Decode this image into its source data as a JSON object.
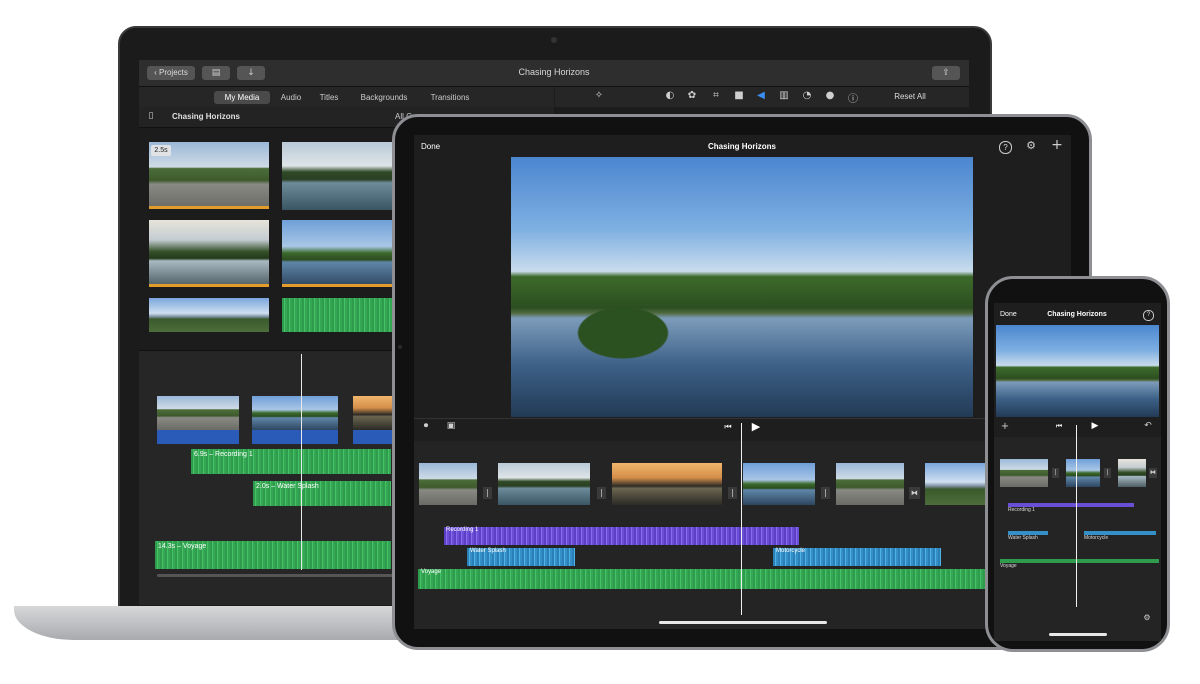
{
  "mac": {
    "toolbar": {
      "projects_label": "Projects",
      "window_title": "Chasing Horizons",
      "reset_all_label": "Reset All"
    },
    "media_tabs": [
      "My Media",
      "Audio",
      "Titles",
      "Backgrounds",
      "Transitions"
    ],
    "library_title": "Chasing Horizons",
    "all_clips_label": "All C",
    "browser_duration_badge": "2.5s",
    "timeline": {
      "recording_label": "6.9s – Recording 1",
      "water_label": "2.0s – Water Splash",
      "voyage_label": "14.3s – Voyage"
    }
  },
  "ipad": {
    "done_label": "Done",
    "title": "Chasing Horizons",
    "help_icon_glyph": "?",
    "tracks": {
      "recording": "Recording 1",
      "water": "Water Splash",
      "motorcycle": "Motorcycle",
      "voyage": "Voyage"
    }
  },
  "iphone": {
    "done_label": "Done",
    "title": "Chasing Horizons",
    "help_icon_glyph": "?",
    "tracks": {
      "recording": "Recording 1",
      "water": "Water Splash",
      "motorcycle": "Motorcycle",
      "voyage": "Voyage"
    }
  },
  "icons": {
    "play": "▶",
    "rewind": "⏮",
    "plus": "+",
    "undo": "↶",
    "mic": "🎙",
    "camera": "📷",
    "gear": "⚙",
    "info": "ⓘ"
  },
  "colors": {
    "accent_green": "#2f9b4c",
    "accent_purple": "#6a4fd6",
    "accent_blue": "#3590c8",
    "volume_icon_blue": "#3a8ef5",
    "clip_audio_blue": "#2a5bb8",
    "clip_edge_orange": "#e39b2b",
    "app_dark": "#1e1e1e"
  }
}
